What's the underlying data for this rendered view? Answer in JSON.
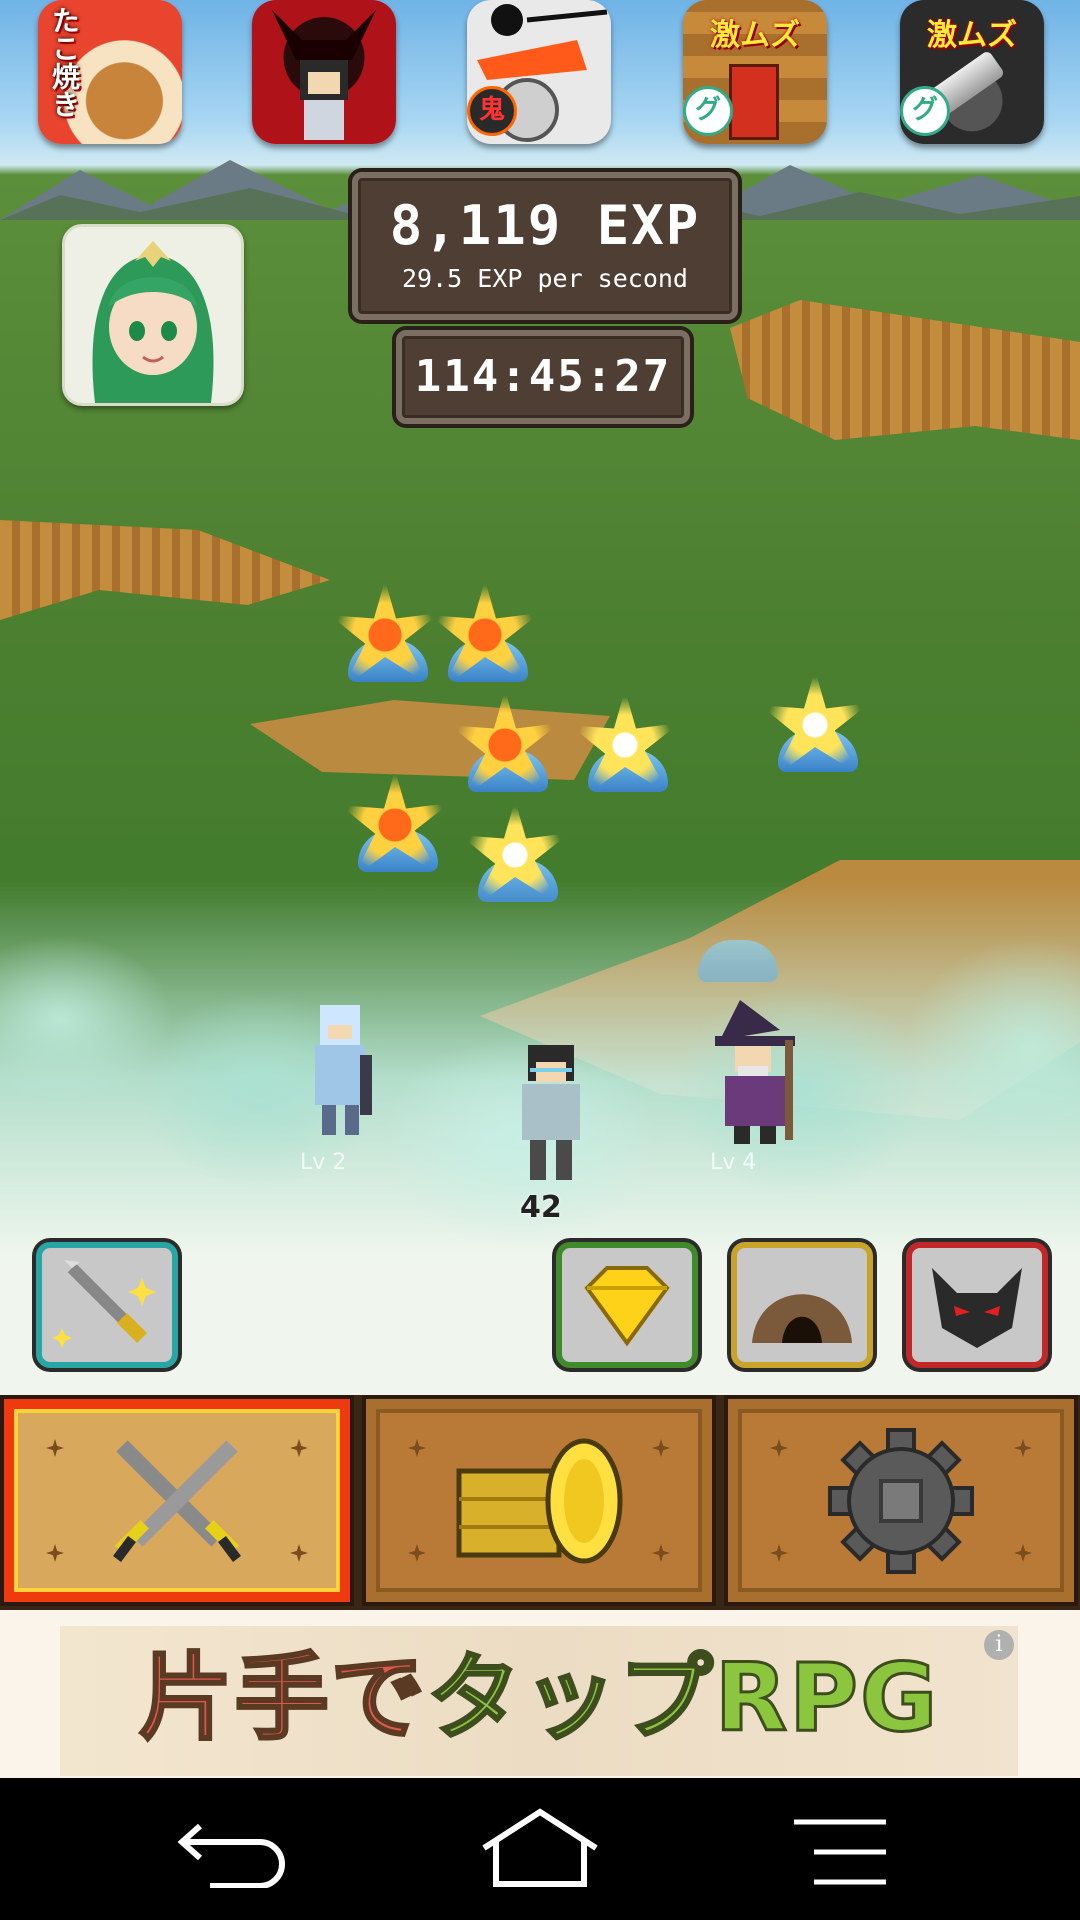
{
  "promo_apps": [
    {
      "icon": "takoyaki-app-icon",
      "label": "たこ焼き",
      "bg": "#e8442e"
    },
    {
      "icon": "demon-knight-app-icon",
      "label": "",
      "bg": "#b0121a"
    },
    {
      "icon": "oni-laser-app-icon",
      "label": "",
      "bg": "#e6e6e6",
      "badge": "鬼"
    },
    {
      "icon": "gekimuzu-door-app-icon",
      "label": "激ムズ",
      "bg": "#c06a1c",
      "badge": "グ"
    },
    {
      "icon": "gekimuzu-hammer-app-icon",
      "label": "激ムズ",
      "bg": "#2b2b2b",
      "badge": "グ"
    }
  ],
  "stats": {
    "exp": "8,119 EXP",
    "exp_rate": "29.5 EXP per second",
    "timer": "114:45:27"
  },
  "heroes": [
    {
      "name": "knight",
      "level": "Lv 2"
    },
    {
      "name": "wanderer",
      "level": "",
      "combat_text": "42"
    },
    {
      "name": "wizard",
      "level": "Lv 4"
    }
  ],
  "skills": [
    {
      "icon": "sword-sparkle-icon",
      "border": "#2aa5a5"
    },
    {
      "icon": "gem-icon",
      "border": "#3f8a2a"
    },
    {
      "icon": "cave-icon",
      "border": "#c8a42a"
    },
    {
      "icon": "demon-icon",
      "border": "#c0282a"
    }
  ],
  "tabs": [
    {
      "icon": "crossed-swords-icon",
      "active": true
    },
    {
      "icon": "coins-icon",
      "active": false
    },
    {
      "icon": "gear-icon",
      "active": false
    }
  ],
  "ad": {
    "text_part1": "片手で",
    "text_part2": "タップ",
    "text_part3": "RPG",
    "info_label": "i"
  },
  "colors": {
    "accent_red": "#ef3a10",
    "panel_bg": "#4e3e34",
    "grass": "#4d8031"
  }
}
